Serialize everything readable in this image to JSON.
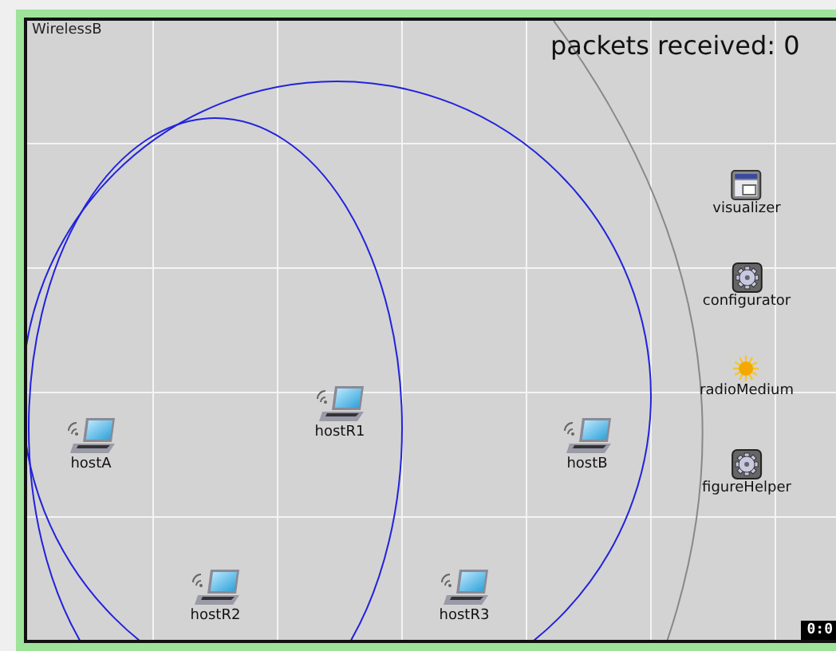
{
  "network": {
    "title": "WirelessB",
    "figure_text": "packets received: 0"
  },
  "nodes": [
    {
      "name": "hostA",
      "kind": "laptop"
    },
    {
      "name": "hostR1",
      "kind": "laptop"
    },
    {
      "name": "hostB",
      "kind": "laptop"
    },
    {
      "name": "hostR2",
      "kind": "laptop"
    },
    {
      "name": "hostR3",
      "kind": "laptop"
    },
    {
      "name": "visualizer",
      "kind": "window"
    },
    {
      "name": "configurator",
      "kind": "gear"
    },
    {
      "name": "radioMedium",
      "kind": "sun"
    },
    {
      "name": "figureHelper",
      "kind": "gear"
    }
  ],
  "sim_time": "0:0"
}
